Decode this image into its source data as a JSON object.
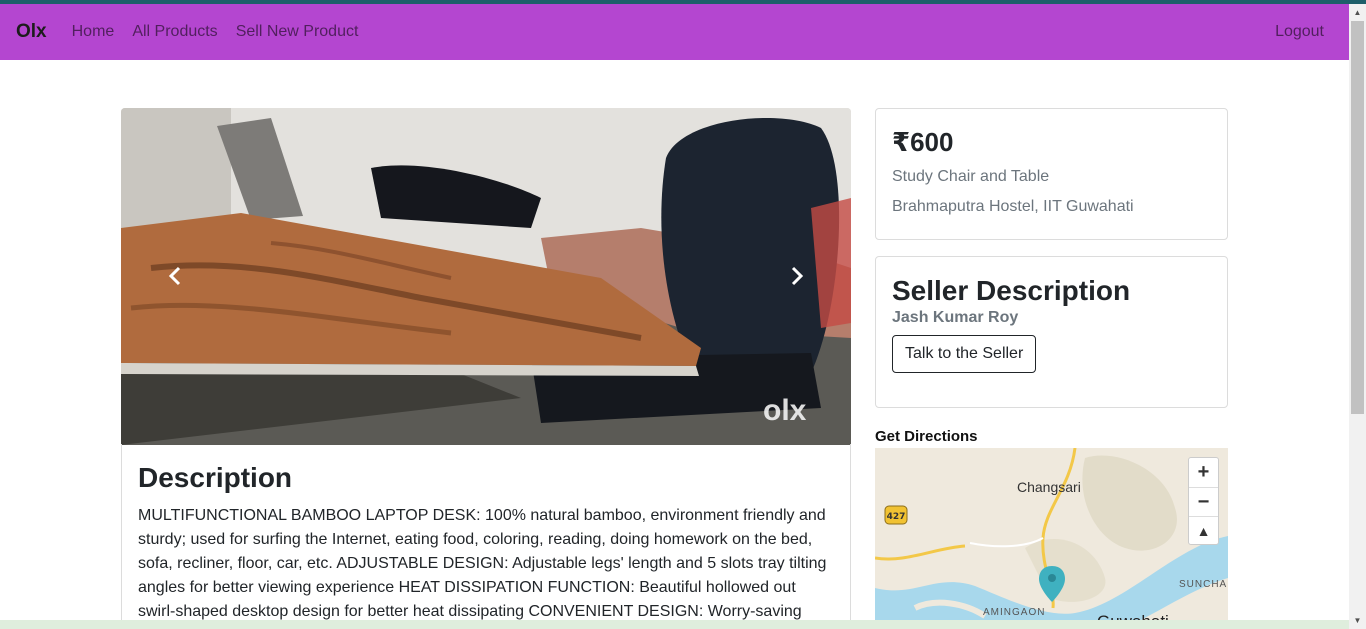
{
  "nav": {
    "brand": "Olx",
    "links": [
      "Home",
      "All Products",
      "Sell New Product"
    ],
    "logout": "Logout"
  },
  "product": {
    "price": "₹600",
    "name": "Study Chair and Table",
    "location": "Brahmaputra Hostel, IIT Guwahati"
  },
  "description": {
    "title": "Description",
    "text": "MULTIFUNCTIONAL BAMBOO LAPTOP DESK: 100% natural bamboo, environment friendly and sturdy; used for surfing the Internet, eating food, coloring, reading, doing homework on the bed, sofa, recliner, floor, car, etc. ADJUSTABLE DESIGN: Adjustable legs' length and 5 slots tray tilting angles for better viewing experience HEAT DISSIPATION FUNCTION: Beautiful hollowed out swirl-shaped desktop design for better heat dissipating CONVENIENT DESIGN: Worry-saving Cup-"
  },
  "seller": {
    "title": "Seller Description",
    "name": "Jash Kumar Roy",
    "button": "Talk to the Seller"
  },
  "directions": {
    "label": "Get Directions",
    "places": [
      "Changsari",
      "AMINGAON",
      "Guwahati",
      "SUNCHA"
    ],
    "route_badge": "427",
    "zoom_in": "+",
    "zoom_out": "−",
    "compass": "▲"
  },
  "carousel": {
    "watermark": "olx",
    "prev_icon": "‹",
    "next_icon": "›"
  },
  "colors": {
    "navbar": "#b446d0",
    "map_land": "#efe9dd",
    "map_water": "#a8d8ec",
    "marker": "#3fb1c0"
  }
}
